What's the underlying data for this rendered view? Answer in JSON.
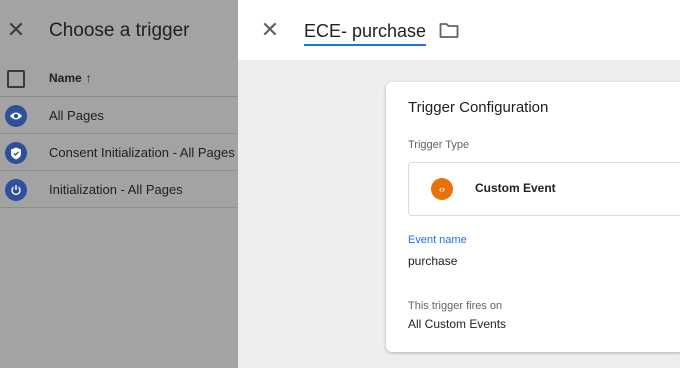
{
  "trigger_list": {
    "title": "Choose a trigger",
    "column_name": "Name",
    "sort_icon": "arrow-up-icon",
    "rows": [
      {
        "label": "All Pages",
        "icon": "eye-icon"
      },
      {
        "label": "Consent Initialization - All Pages",
        "icon": "shield-icon"
      },
      {
        "label": "Initialization - All Pages",
        "icon": "power-icon"
      }
    ]
  },
  "editor": {
    "trigger_name": "ECE- purchase",
    "card_title": "Trigger Configuration",
    "trigger_type_label": "Trigger Type",
    "trigger_type_value": "Custom Event",
    "trigger_type_icon": "code-icon",
    "event_name_label": "Event name",
    "event_name_value": "purchase",
    "fires_on_label": "This trigger fires on",
    "fires_on_value": "All Custom Events"
  },
  "colors": {
    "accent": "#1a73e8",
    "custom_event_icon": "#e8710a",
    "builtin_icon": "#2f4f9c"
  }
}
